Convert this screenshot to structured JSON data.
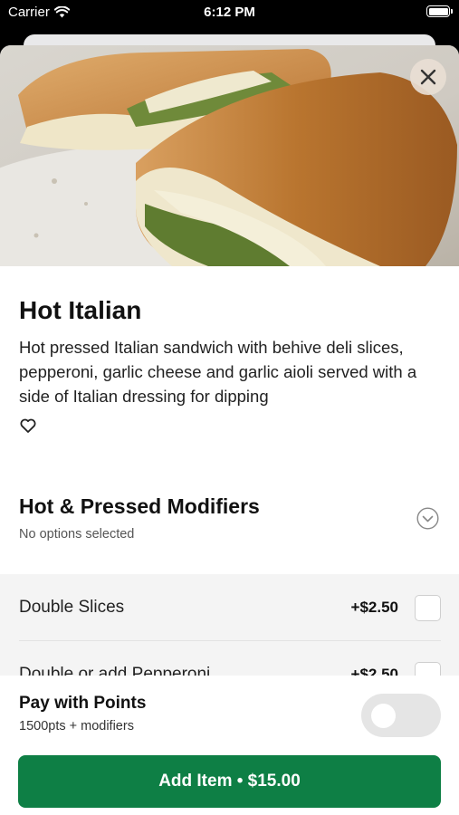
{
  "status_bar": {
    "carrier": "Carrier",
    "time": "6:12 PM",
    "icons": [
      "wifi-icon",
      "battery-icon"
    ]
  },
  "item": {
    "title": "Hot Italian",
    "description": "Hot pressed Italian sandwich with behive deli slices, pepperoni, garlic cheese and garlic aioli served with a side of Italian dressing for dipping",
    "favorite_icon": "heart-outline-icon",
    "close_icon": "close-icon"
  },
  "modifiers": {
    "title": "Hot & Pressed Modifiers",
    "subtitle": "No options selected",
    "expand_icon": "chevron-down-circle-icon",
    "options": [
      {
        "label": "Double Slices",
        "price": "+$2.50",
        "checked": false
      },
      {
        "label": "Double or add Pepperoni",
        "price": "+$2.50",
        "checked": false
      }
    ]
  },
  "footer": {
    "pay_title": "Pay with Points",
    "pay_subtitle": "1500pts + modifiers",
    "pay_toggle_on": false,
    "add_button_label": "Add Item • $15.00"
  },
  "colors": {
    "primary_green": "#0e7f45",
    "toggle_off": "#e5e5e5",
    "close_button_bg": "#e8ded4"
  }
}
